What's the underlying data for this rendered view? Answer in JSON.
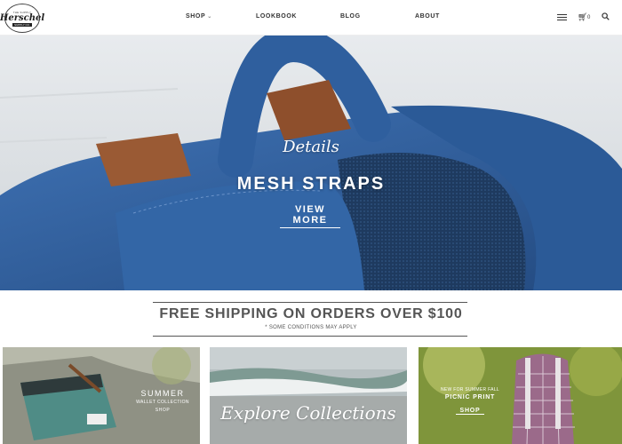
{
  "header": {
    "logo": {
      "brand": "Herschel",
      "tagline": "SUPPLY CO."
    },
    "nav": [
      {
        "label": "SHOP",
        "has_dropdown": true
      },
      {
        "label": "LOOKBOOK"
      },
      {
        "label": "BLOG"
      },
      {
        "label": "ABOUT"
      }
    ],
    "cart_count": "0",
    "icons": [
      "flag-icon",
      "cart-icon",
      "search-icon"
    ]
  },
  "hero": {
    "script": "Details",
    "title": "MESH STRAPS",
    "cta": "VIEW MORE"
  },
  "shipping": {
    "title": "FREE SHIPPING ON ORDERS OVER $100",
    "note": "* SOME CONDITIONS MAY APPLY"
  },
  "tiles": [
    {
      "title": "SUMMER",
      "subtitle": "WALLET COLLECTION",
      "cta": "SHOP"
    },
    {
      "title": "Explore Collections"
    },
    {
      "kicker": "NEW FOR SUMMER FALL",
      "title": "PICNIC PRINT",
      "cta": "SHOP"
    }
  ],
  "colors": {
    "backpack_blue": "#2f5f9e",
    "leather": "#9a5a34",
    "text_gray": "#555555"
  }
}
